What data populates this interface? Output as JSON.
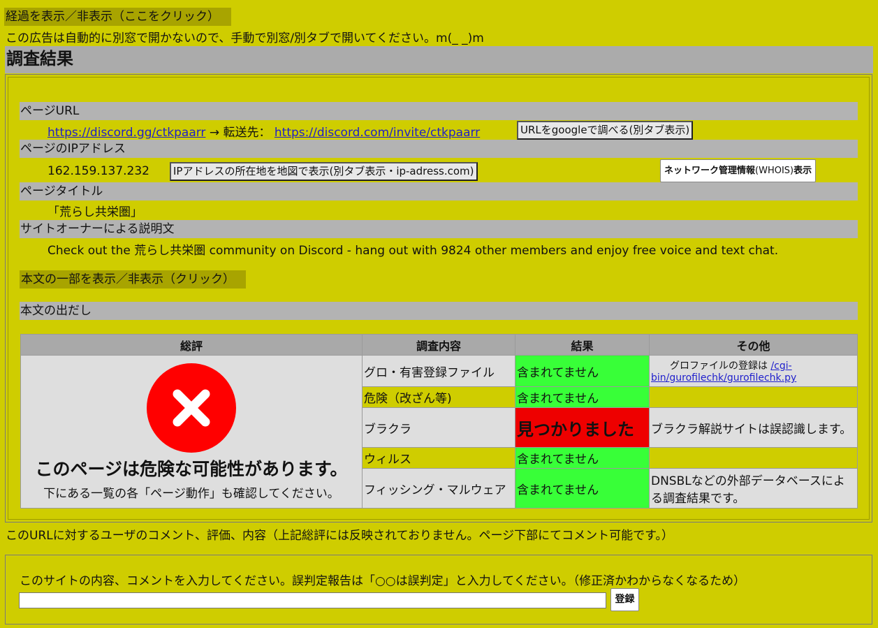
{
  "top": {
    "toggle_progress": "経過を表示／非表示（ここをクリック）",
    "ad_notice": "この広告は自動的に別窓で開かないので、手動で別窓/別タブで開いてください。m(_ _)m"
  },
  "heading": "調査結果",
  "page_url": {
    "label": "ページURL",
    "url": "https://discord.gg/ctkpaarr",
    "arrow": "→ 転送先：",
    "redirect_url": "https://discord.com/invite/ctkpaarr",
    "google_button": "URLをgoogleで調べる(別タブ表示)"
  },
  "ip": {
    "label": "ページのIPアドレス",
    "address": "162.159.137.232",
    "map_button": "IPアドレスの所在地を地図で表示(別タブ表示・ip-adress.com)",
    "whois_button_bold1": "ネットワーク管理情報",
    "whois_button_normal": "(WHOIS)",
    "whois_button_bold2": "表示"
  },
  "title": {
    "label": "ページタイトル",
    "value": "「荒らし共栄圏」"
  },
  "description": {
    "label": "サイトオーナーによる説明文",
    "value": "Check out the 荒らし共栄圏 community on Discord - hang out with 9824 other members and enjoy free voice and text chat."
  },
  "body_toggle": "本文の一部を表示／非表示（クリック）",
  "body_start_label": "本文の出だし",
  "table": {
    "headers": [
      "総評",
      "調査内容",
      "結果",
      "その他"
    ],
    "summary_main": "このページは危険な可能性があります。",
    "summary_sub": "下にある一覧の各「ページ動作」も確認してください。",
    "rows": [
      {
        "item": "グロ・有害登録ファイル",
        "result": "含まれてません",
        "note_prefix": "グロファイルの登録は ",
        "note_link": "/cgi-bin/gurofilechk/gurofilechk.py"
      },
      {
        "item": "危険（改ざん等)",
        "result": "含まれてません",
        "note": ""
      },
      {
        "item": "ブラクラ",
        "result": "見つかりました",
        "note": "ブラクラ解説サイトは誤認識します。"
      },
      {
        "item": "ウィルス",
        "result": "含まれてません",
        "note": ""
      },
      {
        "item": "フィッシング・マルウェア",
        "result": "含まれてません",
        "note": "DNSBLなどの外部データベースによる調査結果です。"
      }
    ]
  },
  "user_comment_notice": "このURLに対するユーザのコメント、評価、内容（上記総評には反映されておりません。ページ下部にてコメント可能です。）",
  "comment_form": {
    "prompt": "このサイトの内容、コメントを入力してください。誤判定報告は「○○は誤判定」と入力してください。（修正済かわからなくなるため）",
    "input_value": "",
    "submit_label": "登録"
  },
  "colors": {
    "background": "#cfcd00",
    "ok": "#38ff38",
    "ng": "#ee0000",
    "danger_icon": "#ff0000"
  }
}
